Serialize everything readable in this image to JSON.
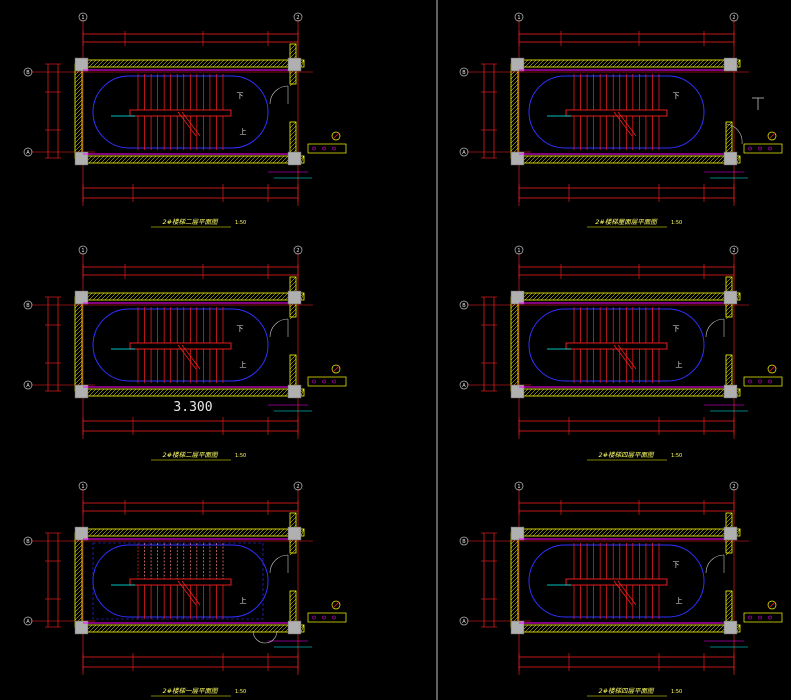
{
  "panels": [
    {
      "title": "2#楼梯二层平面图",
      "scale": "1:50",
      "up_char": "下",
      "down_char": "上",
      "grid_left": "1",
      "grid_right": "2",
      "grid_top": "B",
      "grid_bottom": "A"
    },
    {
      "title": "2#楼梯屋面层平面图",
      "scale": "1:50",
      "up_char": "下",
      "down_char": "",
      "grid_left": "1",
      "grid_right": "2",
      "grid_top": "B",
      "grid_bottom": "A"
    },
    {
      "title": "2#楼梯二层平面图",
      "scale": "1:50",
      "up_char": "下",
      "down_char": "上",
      "grid_left": "1",
      "grid_right": "2",
      "grid_top": "B",
      "grid_bottom": "A"
    },
    {
      "title": "2#楼梯四层平面图",
      "scale": "1:50",
      "up_char": "下",
      "down_char": "上",
      "grid_left": "1",
      "grid_right": "2",
      "grid_top": "B",
      "grid_bottom": "A"
    },
    {
      "title": "2#楼梯一层平面图",
      "scale": "1:50",
      "up_char": "",
      "down_char": "上",
      "grid_left": "1",
      "grid_right": "2",
      "grid_top": "B",
      "grid_bottom": "A"
    },
    {
      "title": "2#楼梯四层平面图",
      "scale": "1:50",
      "up_char": "下",
      "down_char": "上",
      "grid_left": "1",
      "grid_right": "2",
      "grid_top": "B",
      "grid_bottom": "A"
    }
  ],
  "elevation_note": "3.300",
  "colors": {
    "background": "#000000",
    "wall_hatch": "#ffff00",
    "column": "#b0b0b0",
    "stairs": "#ff2020",
    "dimension": "#ff2020",
    "arc": "#3030ff",
    "railing": "#ff00ff",
    "annotation": "#00ffff",
    "divider": "#c0c0c0"
  }
}
